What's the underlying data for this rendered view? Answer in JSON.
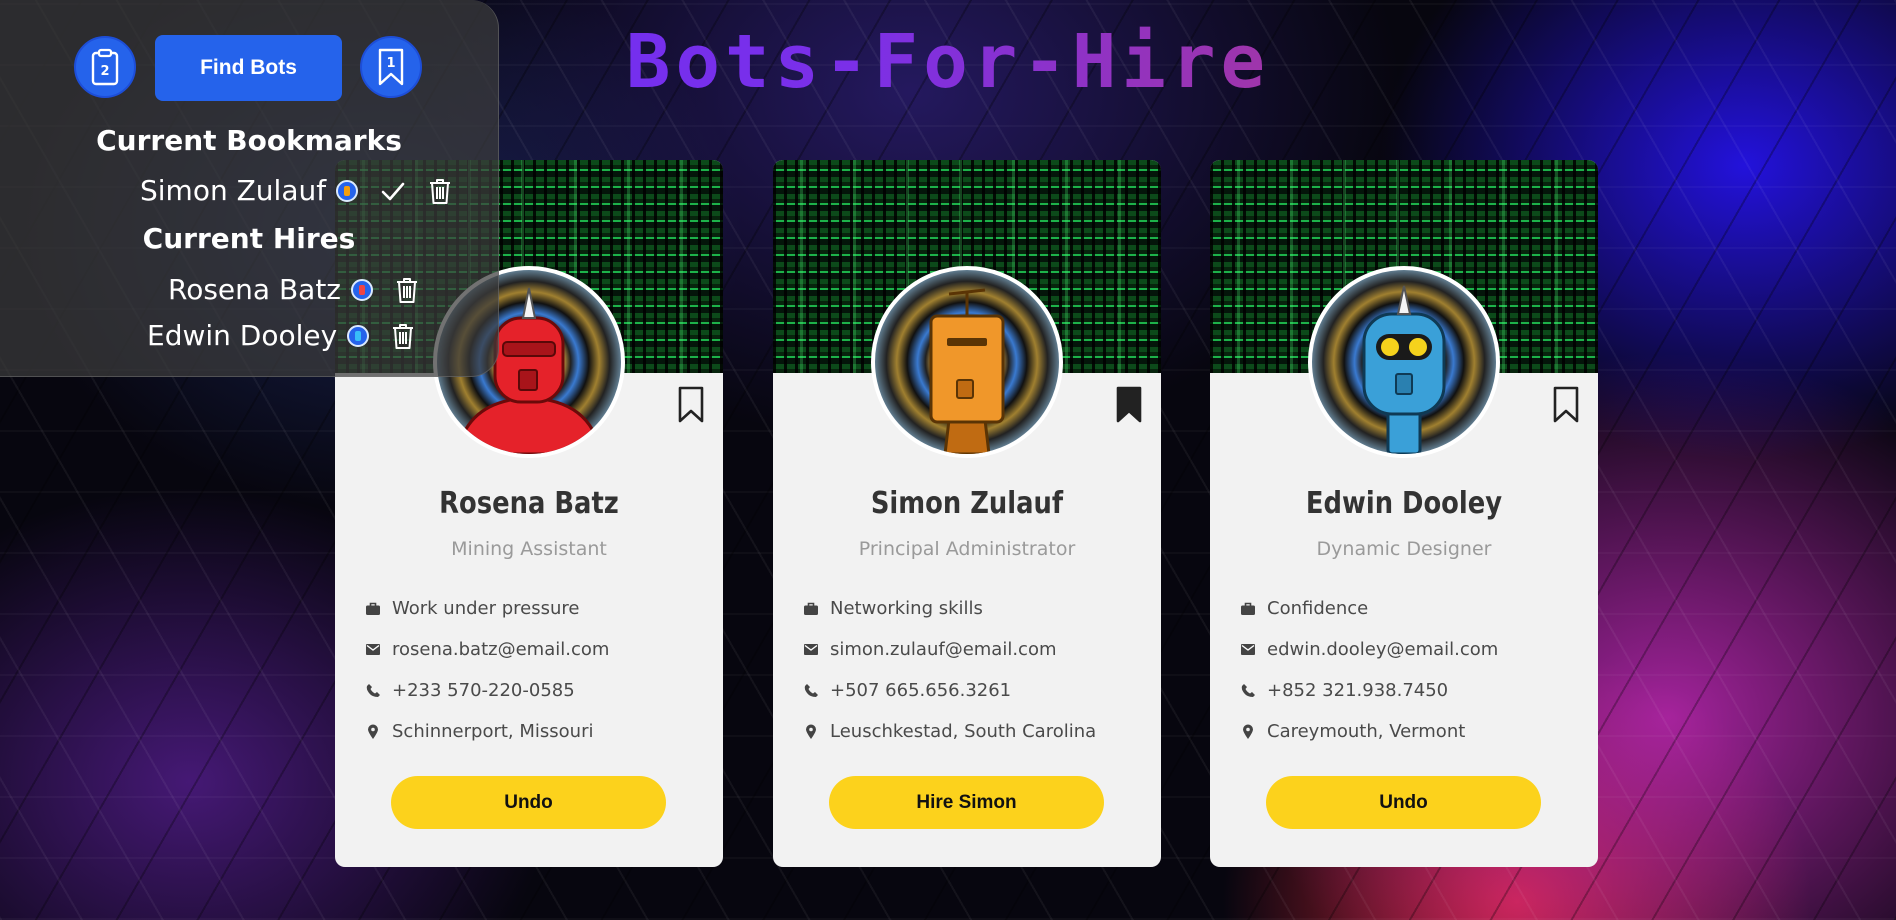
{
  "app": {
    "logo": "Bots-For-Hire"
  },
  "nav": {
    "hires_count": "2",
    "find_label": "Find Bots",
    "bookmarks_count": "1"
  },
  "panel": {
    "bookmarks_heading": "Current Bookmarks",
    "hires_heading": "Current Hires",
    "bookmarks": [
      {
        "name": "Simon Zulauf",
        "avatar_color": "#f59e0b"
      }
    ],
    "hires": [
      {
        "name": "Rosena Batz",
        "avatar_color": "#ef4444"
      },
      {
        "name": "Edwin Dooley",
        "avatar_color": "#38bdf8"
      }
    ]
  },
  "bots": [
    {
      "name": "Rosena Batz",
      "title": "Mining Assistant",
      "skill": "Work under pressure",
      "email": "rosena.batz@email.com",
      "phone": "+233 570-220-0585",
      "location": "Schinnerport, Missouri",
      "action": "Undo",
      "bookmarked": false,
      "robot_color": "#e5222a"
    },
    {
      "name": "Simon Zulauf",
      "title": "Principal Administrator",
      "skill": "Networking skills",
      "email": "simon.zulauf@email.com",
      "phone": "+507 665.656.3261",
      "location": "Leuschkestad, South Carolina",
      "action": "Hire Simon",
      "bookmarked": true,
      "robot_color": "#f0972a"
    },
    {
      "name": "Edwin Dooley",
      "title": "Dynamic Designer",
      "skill": "Confidence",
      "email": "edwin.dooley@email.com",
      "phone": "+852 321.938.7450",
      "location": "Careymouth, Vermont",
      "action": "Undo",
      "bookmarked": false,
      "robot_color": "#3aa0d8"
    }
  ],
  "colors": {
    "primary": "#2563eb",
    "action_button": "#fcd21c",
    "card_bg": "#f2f2f2"
  }
}
